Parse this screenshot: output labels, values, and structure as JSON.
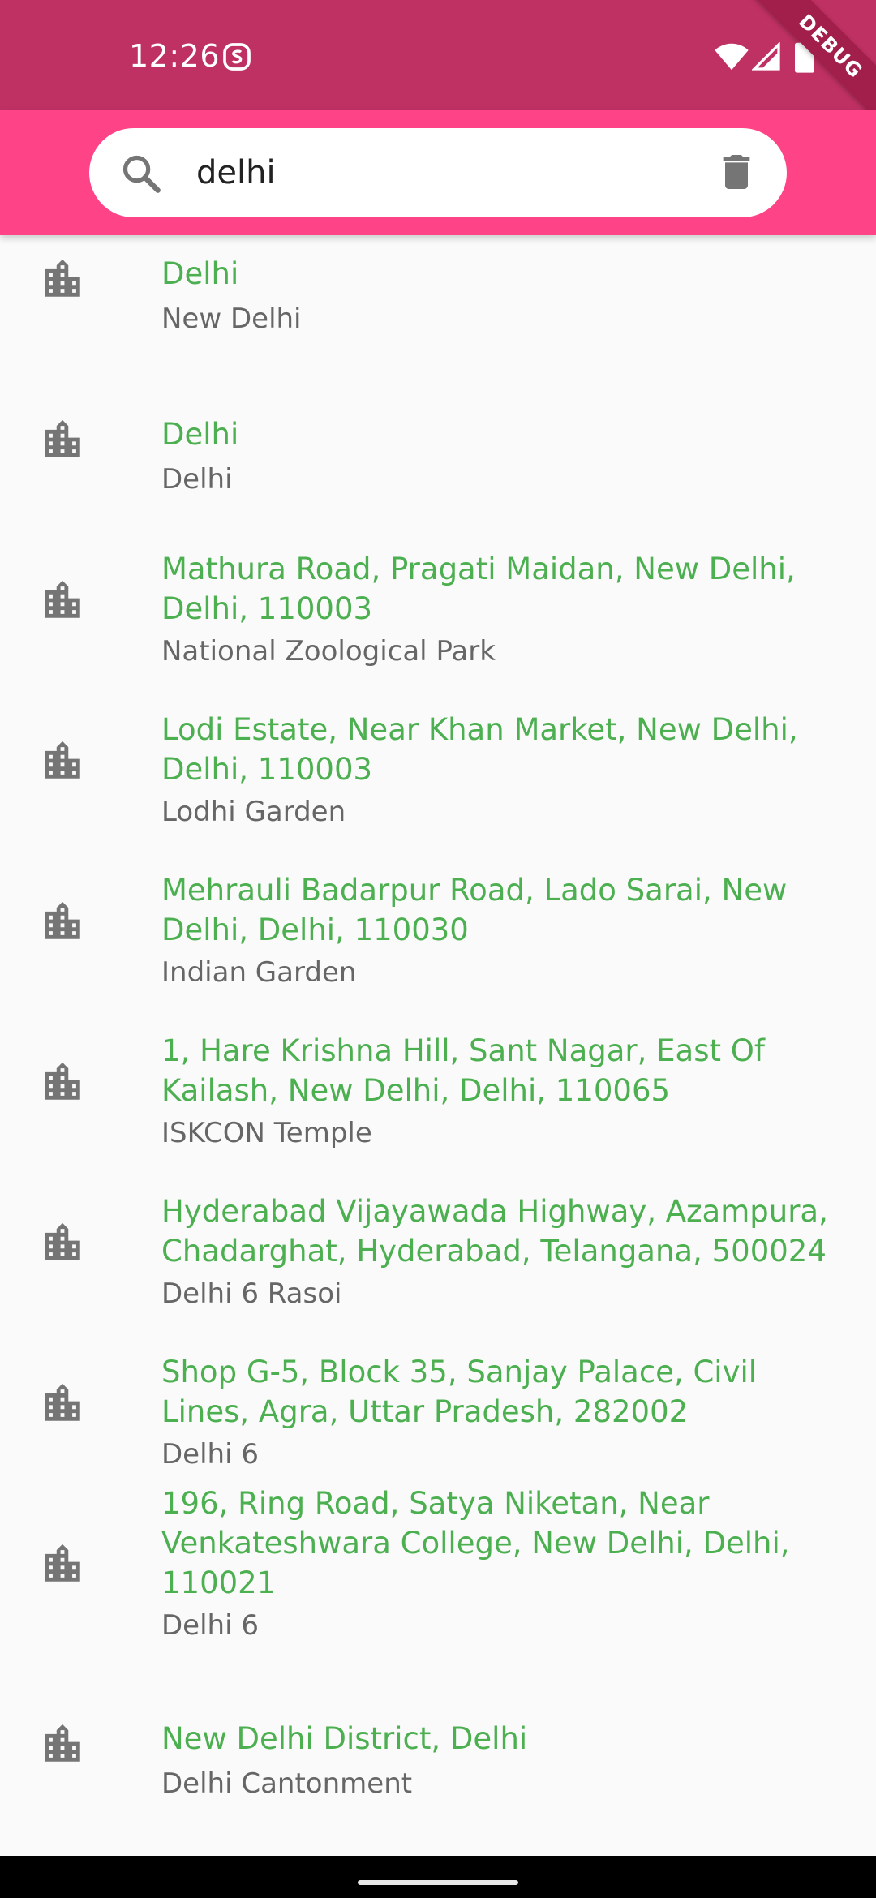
{
  "status_bar": {
    "time": "12:26",
    "background": "#bf3063",
    "icons": [
      "s-badge-icon",
      "wifi-icon",
      "cell-signal-icon",
      "battery-icon"
    ]
  },
  "debug_banner": "DEBUG",
  "search": {
    "value": "delhi",
    "background": "#fe4486"
  },
  "colors": {
    "title": "#4caf50",
    "subtitle": "#666666",
    "icon": "#757575"
  },
  "results": [
    {
      "icon": "city-icon",
      "title": "Delhi",
      "subtitle": "New Delhi"
    },
    {
      "icon": "city-icon",
      "title": "Delhi",
      "subtitle": "Delhi"
    },
    {
      "icon": "city-icon",
      "title": "Mathura Road, Pragati Maidan, New Delhi, Delhi, 110003",
      "subtitle": "National Zoological Park"
    },
    {
      "icon": "city-icon",
      "title": "Lodi Estate, Near Khan Market, New Delhi, Delhi, 110003",
      "subtitle": "Lodhi Garden"
    },
    {
      "icon": "city-icon",
      "title": "Mehrauli Badarpur Road, Lado Sarai, New Delhi, Delhi, 110030",
      "subtitle": "Indian Garden"
    },
    {
      "icon": "city-icon",
      "title": "1, Hare Krishna Hill, Sant Nagar, East Of Kailash, New Delhi, Delhi, 110065",
      "subtitle": "ISKCON Temple"
    },
    {
      "icon": "city-icon",
      "title": "Hyderabad Vijayawada Highway, Azampura, Chadarghat, Hyderabad, Telangana, 500024",
      "subtitle": "Delhi 6 Rasoi"
    },
    {
      "icon": "city-icon",
      "title": "Shop G-5, Block 35, Sanjay Palace, Civil Lines, Agra, Uttar Pradesh, 282002",
      "subtitle": "Delhi 6"
    },
    {
      "icon": "city-icon",
      "title": "196, Ring Road, Satya Niketan, Near Venkateshwara College, New Delhi, Delhi, 110021",
      "subtitle": "Delhi 6"
    },
    {
      "icon": "city-icon",
      "title": "New Delhi District, Delhi",
      "subtitle": "Delhi Cantonment"
    }
  ]
}
